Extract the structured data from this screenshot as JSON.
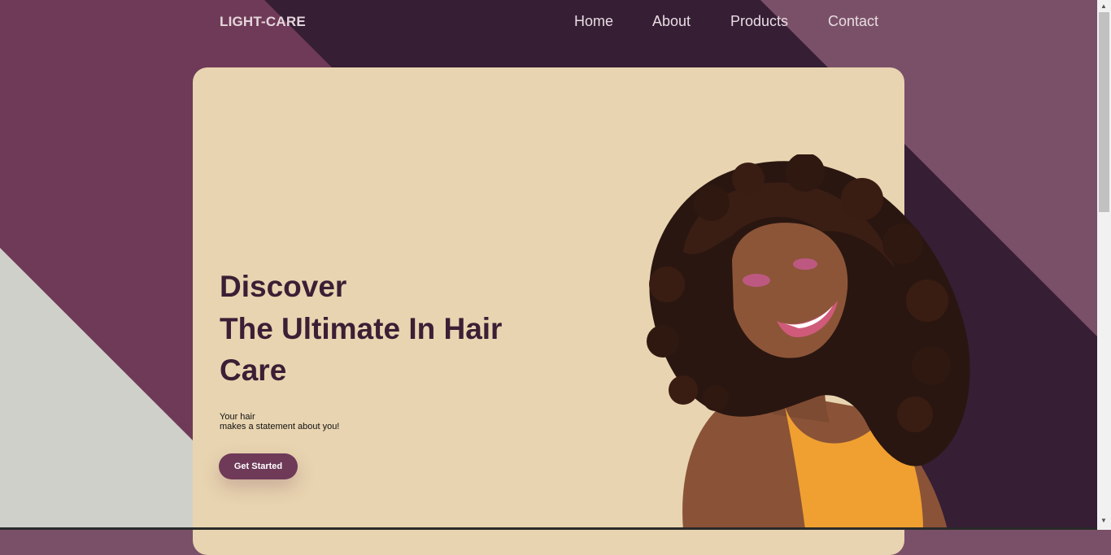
{
  "nav": {
    "logo": "LIGHT-CARE",
    "links": [
      {
        "label": "Home"
      },
      {
        "label": "About"
      },
      {
        "label": "Products"
      },
      {
        "label": "Contact"
      }
    ]
  },
  "hero": {
    "headline_lines": [
      "Discover",
      "The Ultimate In Hair",
      "Care"
    ],
    "subtitle_lines": [
      "Your hair",
      "makes a statement about you!"
    ],
    "cta_label": "Get Started"
  },
  "colors": {
    "plum": "#6f3a57",
    "dark_plum": "#361e35",
    "mauve": "#7a5068",
    "card": "#e8d4b0",
    "gray": "#d0d0cb",
    "headline": "#3a1f35",
    "button": "#6e3a58"
  },
  "scrollbar": {
    "up_icon": "▲",
    "down_icon": "▼"
  }
}
